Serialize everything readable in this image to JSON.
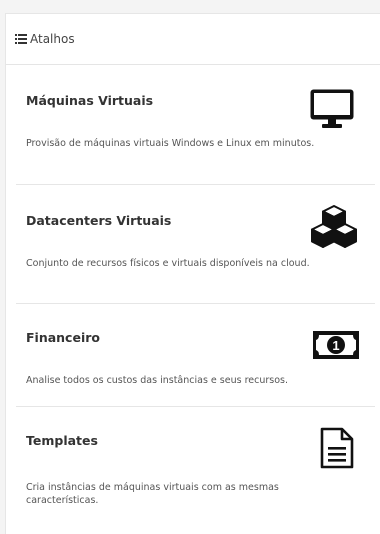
{
  "header": {
    "title": "Atalhos",
    "icon": "list-icon"
  },
  "shortcuts": [
    {
      "title": "Máquinas Virtuais",
      "description": "Provisão de máquinas virtuais Windows e Linux em minutos.",
      "icon": "desktop-icon"
    },
    {
      "title": "Datacenters Virtuais",
      "description": "Conjunto de recursos físicos e virtuais disponíveis na cloud.",
      "icon": "cubes-icon"
    },
    {
      "title": "Financeiro",
      "description": "Analise todos os custos das instâncias e seus recursos.",
      "icon": "money-icon",
      "icon_label": "1"
    },
    {
      "title": "Templates",
      "description": "Cria instâncias de máquinas virtuais com as mesmas características.",
      "icon": "file-text-icon"
    }
  ],
  "colors": {
    "text": "#333333",
    "divider": "#e6e6e6",
    "background": "#f4f4f4",
    "panel": "#ffffff"
  }
}
